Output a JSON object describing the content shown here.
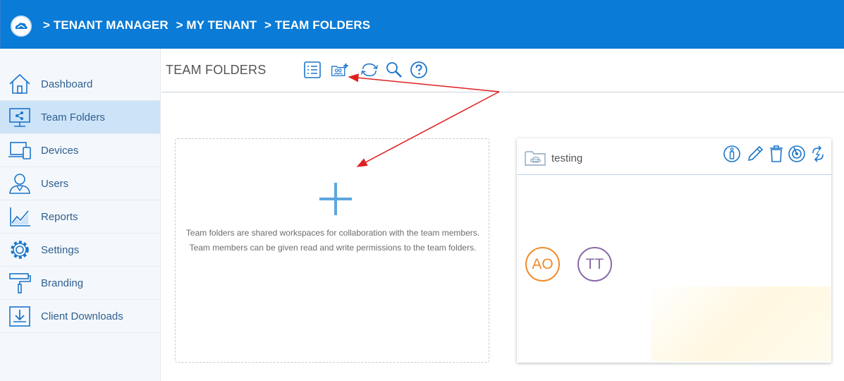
{
  "header": {
    "breadcrumb": [
      "> TENANT MANAGER",
      "> MY TENANT",
      "> TEAM FOLDERS"
    ]
  },
  "sidebar": {
    "items": [
      {
        "label": "Dashboard",
        "icon": "home-icon"
      },
      {
        "label": "Team Folders",
        "icon": "team-folder-icon",
        "active": true
      },
      {
        "label": "Devices",
        "icon": "devices-icon"
      },
      {
        "label": "Users",
        "icon": "users-icon"
      },
      {
        "label": "Reports",
        "icon": "reports-chart-icon"
      },
      {
        "label": "Settings",
        "icon": "gear-icon"
      },
      {
        "label": "Branding",
        "icon": "paint-roller-icon"
      },
      {
        "label": "Client Downloads",
        "icon": "download-icon"
      }
    ]
  },
  "main": {
    "title": "TEAM FOLDERS",
    "toolbar": [
      "list-view-icon",
      "add-team-folder-icon",
      "refresh-icon",
      "search-icon",
      "help-icon"
    ]
  },
  "add_card": {
    "description": "Team folders are shared workspaces for collaboration with the team members. Team members can be given read and write permissions to the team folders."
  },
  "folder_card": {
    "name": "testing",
    "actions": [
      "info-icon",
      "edit-pencil-icon",
      "trash-icon",
      "storage-icon",
      "sync-icon"
    ],
    "members": [
      "AO",
      "TT"
    ]
  },
  "colors": {
    "header_blue": "#0a7bd6",
    "icon_blue": "#1b75c9",
    "active_nav": "#cde3f8",
    "annotation_red": "#e02020",
    "member_ao": "#f08b2a",
    "member_tt": "#8a6aa6"
  }
}
